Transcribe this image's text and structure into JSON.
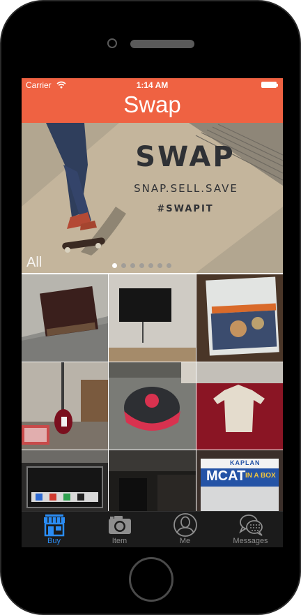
{
  "status_bar": {
    "carrier": "Carrier",
    "time": "1:14 AM"
  },
  "header": {
    "title": "Swap",
    "color": "#ef6242"
  },
  "banner": {
    "title": "SWAP",
    "tagline": "SNAP.SELL.SAVE",
    "hashtag": "#SWAPIT",
    "category_label": "All",
    "page_count": 7,
    "active_page": 0
  },
  "grid": {
    "items": [
      {
        "name": "leather-portfolio-photo"
      },
      {
        "name": "wall-tv-photo"
      },
      {
        "name": "notebook-photo"
      },
      {
        "name": "guitar-photo"
      },
      {
        "name": "bulls-cap-photo"
      },
      {
        "name": "shirt-photo"
      },
      {
        "name": "poker-chips-photo"
      },
      {
        "name": "room-photo"
      },
      {
        "name": "mcat-box-photo"
      }
    ],
    "mcat_box_text": "MCAT",
    "mcat_box_sub": "IN A BOX",
    "mcat_brand": "KAPLAN"
  },
  "tab_bar": {
    "tabs": [
      {
        "label": "Buy",
        "icon": "store-icon",
        "active": true
      },
      {
        "label": "Item",
        "icon": "camera-icon",
        "active": false
      },
      {
        "label": "Me",
        "icon": "person-icon",
        "active": false
      },
      {
        "label": "Messages",
        "icon": "chat-bubbles-icon",
        "active": false
      }
    ],
    "active_color": "#2a8cf4"
  }
}
